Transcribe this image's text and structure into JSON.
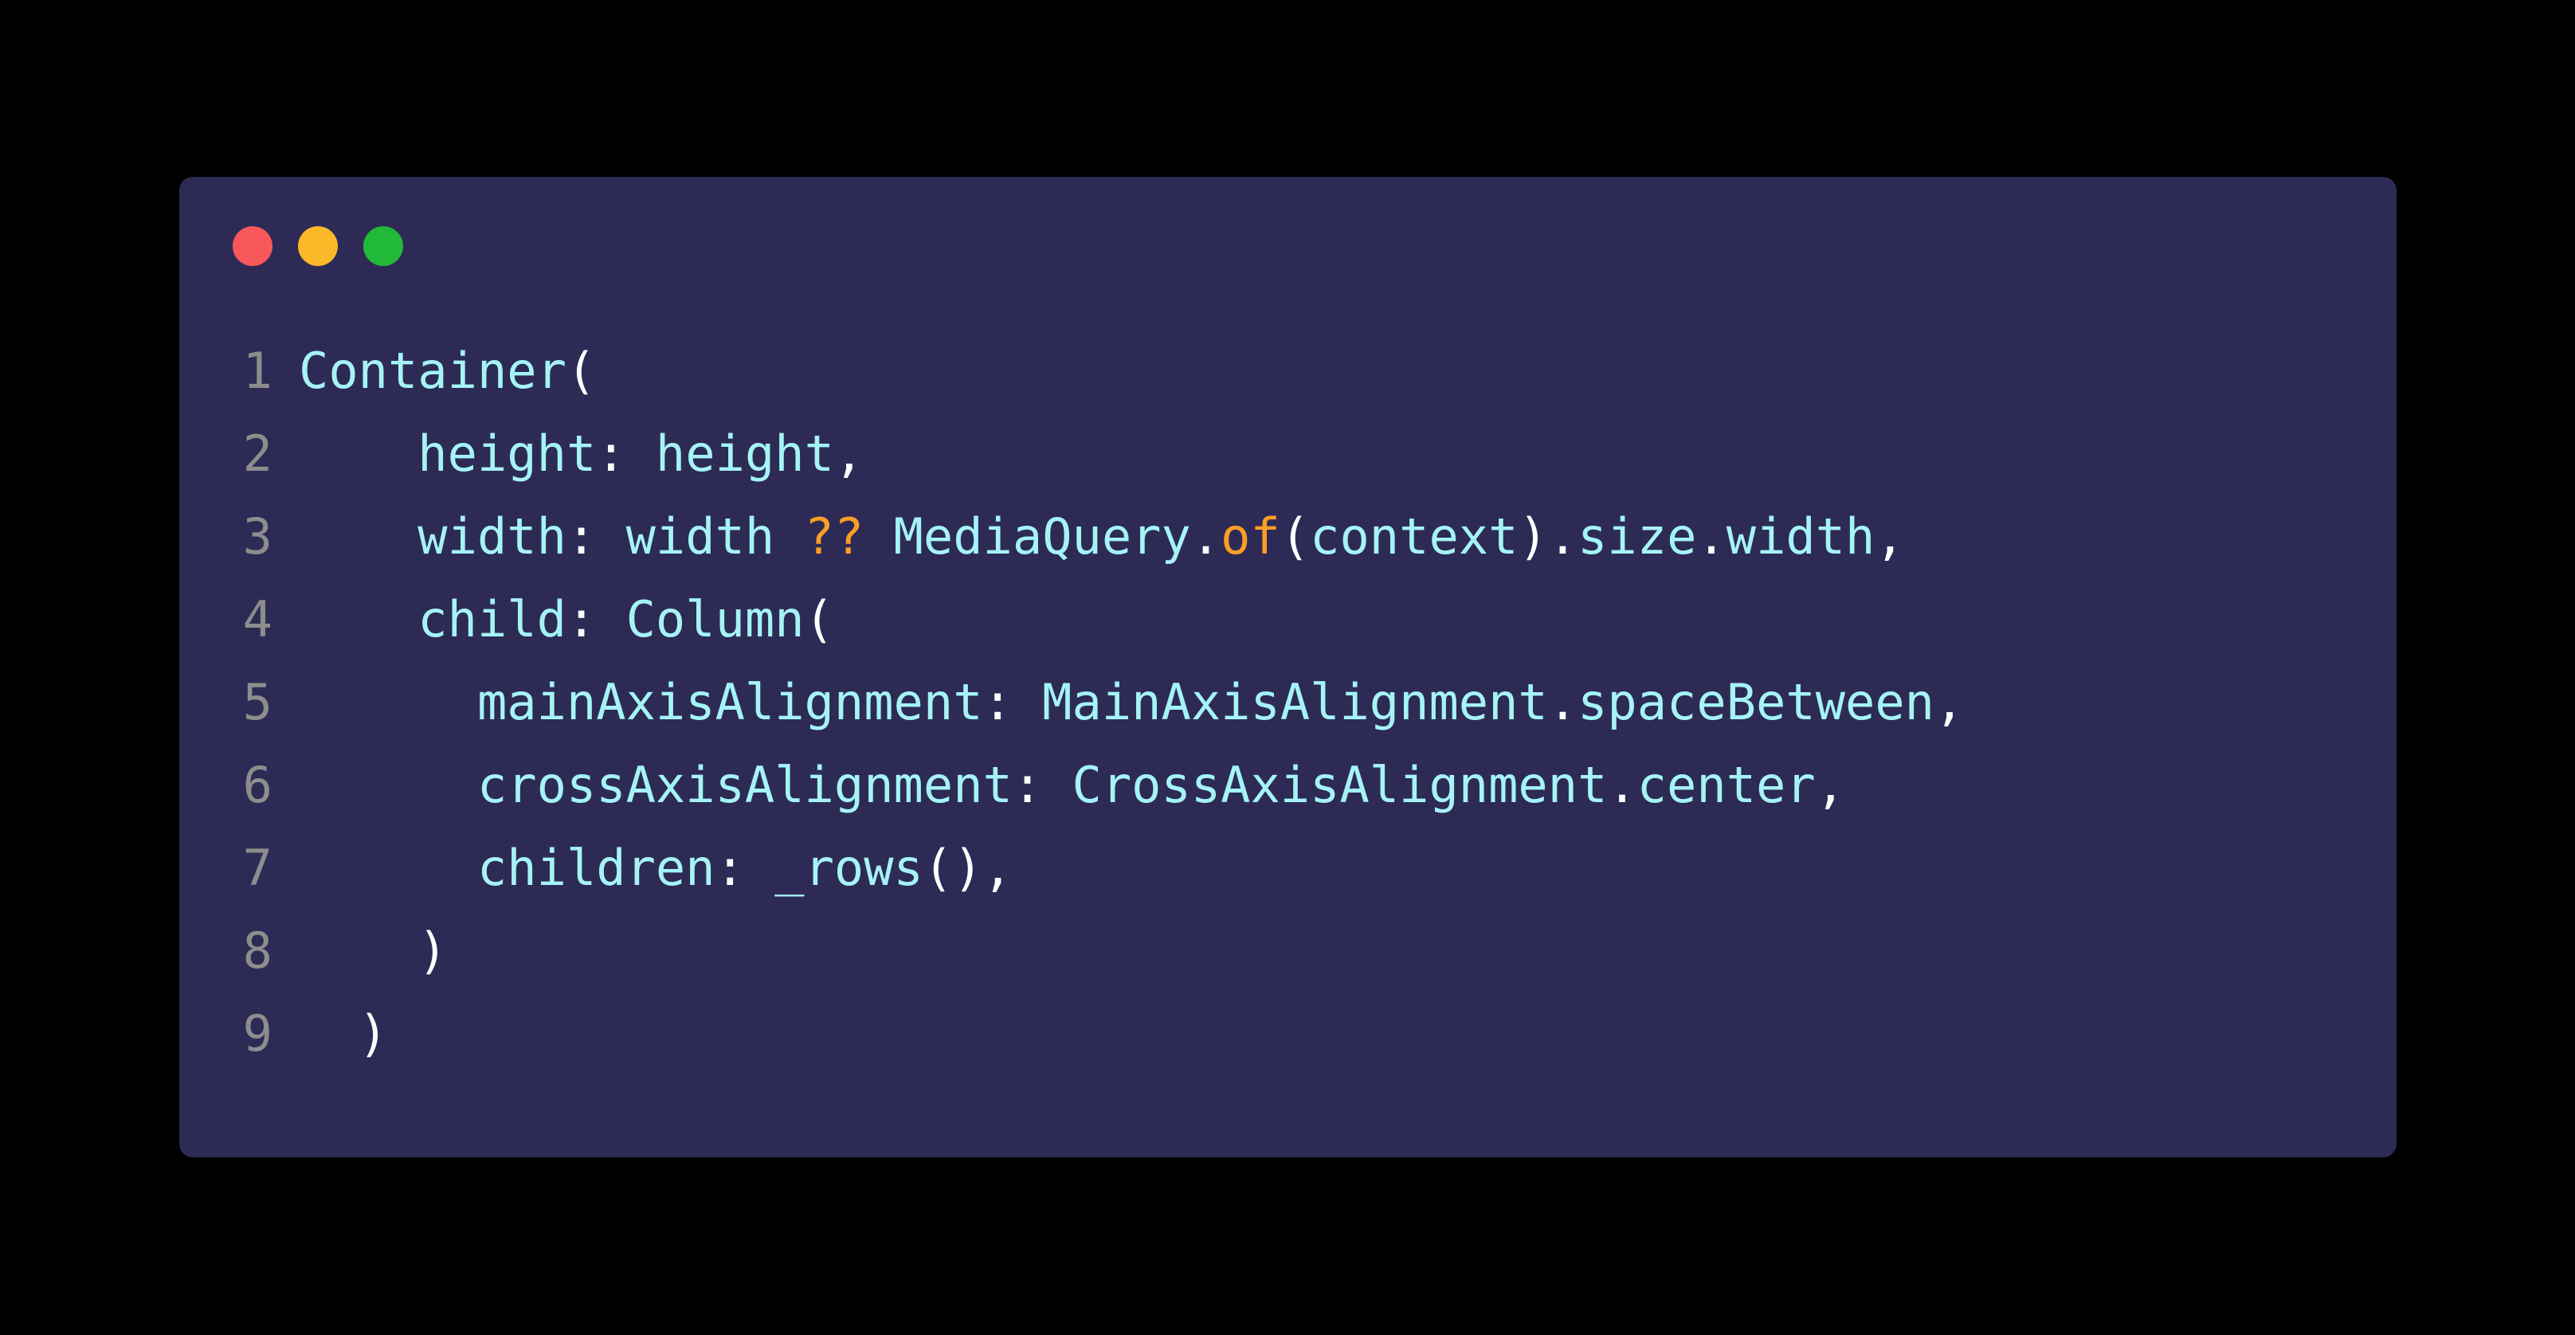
{
  "window": {
    "background_color": "#000000",
    "card_color": "#2d2b55",
    "controls": [
      {
        "name": "close",
        "color": "#f9585a"
      },
      {
        "name": "minimize",
        "color": "#fbb829"
      },
      {
        "name": "zoom",
        "color": "#22b939"
      }
    ]
  },
  "editor": {
    "language": "dart",
    "line_number_color": "#8d8d8d",
    "default_text_color": "#a5f3f7",
    "punctuation_color": "#ffffff",
    "operator_color": "#fb9e25",
    "lines": [
      {
        "number": "1",
        "text": "Container(",
        "tokens": [
          {
            "t": "Container",
            "c": "ident"
          },
          {
            "t": "(",
            "c": "punct"
          }
        ]
      },
      {
        "number": "2",
        "text": "    height: height,",
        "tokens": [
          {
            "t": "    height",
            "c": "ident"
          },
          {
            "t": ":",
            "c": "punct"
          },
          {
            "t": " height",
            "c": "ident"
          },
          {
            "t": ",",
            "c": "punct"
          }
        ]
      },
      {
        "number": "3",
        "text": "    width: width ?? MediaQuery.of(context).size.width,",
        "tokens": [
          {
            "t": "    width",
            "c": "ident"
          },
          {
            "t": ":",
            "c": "punct"
          },
          {
            "t": " width ",
            "c": "ident"
          },
          {
            "t": "??",
            "c": "op"
          },
          {
            "t": " MediaQuery",
            "c": "ident"
          },
          {
            "t": ".",
            "c": "punct"
          },
          {
            "t": "of",
            "c": "method"
          },
          {
            "t": "(",
            "c": "punct"
          },
          {
            "t": "context",
            "c": "ident"
          },
          {
            "t": ")",
            "c": "punct"
          },
          {
            "t": ".",
            "c": "punct"
          },
          {
            "t": "size",
            "c": "ident"
          },
          {
            "t": ".",
            "c": "punct"
          },
          {
            "t": "width",
            "c": "ident"
          },
          {
            "t": ",",
            "c": "punct"
          }
        ]
      },
      {
        "number": "4",
        "text": "    child: Column(",
        "tokens": [
          {
            "t": "    child",
            "c": "ident"
          },
          {
            "t": ":",
            "c": "punct"
          },
          {
            "t": " Column",
            "c": "ident"
          },
          {
            "t": "(",
            "c": "punct"
          }
        ]
      },
      {
        "number": "5",
        "text": "      mainAxisAlignment: MainAxisAlignment.spaceBetween,",
        "tokens": [
          {
            "t": "      mainAxisAlignment",
            "c": "ident"
          },
          {
            "t": ":",
            "c": "punct"
          },
          {
            "t": " MainAxisAlignment",
            "c": "ident"
          },
          {
            "t": ".",
            "c": "punct"
          },
          {
            "t": "spaceBetween",
            "c": "ident"
          },
          {
            "t": ",",
            "c": "punct"
          }
        ]
      },
      {
        "number": "6",
        "text": "      crossAxisAlignment: CrossAxisAlignment.center,",
        "tokens": [
          {
            "t": "      crossAxisAlignment",
            "c": "ident"
          },
          {
            "t": ":",
            "c": "punct"
          },
          {
            "t": " CrossAxisAlignment",
            "c": "ident"
          },
          {
            "t": ".",
            "c": "punct"
          },
          {
            "t": "center",
            "c": "ident"
          },
          {
            "t": ",",
            "c": "punct"
          }
        ]
      },
      {
        "number": "7",
        "text": "      children: _rows(),",
        "tokens": [
          {
            "t": "      children",
            "c": "ident"
          },
          {
            "t": ":",
            "c": "punct"
          },
          {
            "t": " _rows",
            "c": "ident"
          },
          {
            "t": "()",
            "c": "punct"
          },
          {
            "t": ",",
            "c": "punct"
          }
        ]
      },
      {
        "number": "8",
        "text": "    )",
        "tokens": [
          {
            "t": "    ",
            "c": "ident"
          },
          {
            "t": ")",
            "c": "punct"
          }
        ]
      },
      {
        "number": "9",
        "text": "  )",
        "tokens": [
          {
            "t": "  ",
            "c": "ident"
          },
          {
            "t": ")",
            "c": "punct"
          }
        ]
      }
    ]
  }
}
